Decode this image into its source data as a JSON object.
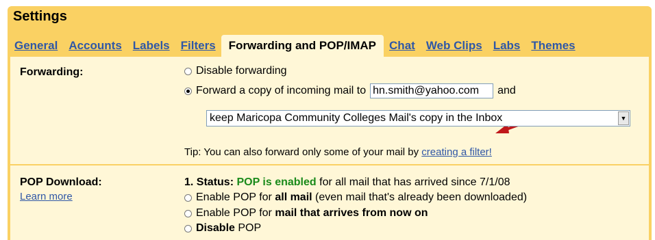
{
  "settings": {
    "title": "Settings"
  },
  "tabs": [
    {
      "label": "General"
    },
    {
      "label": "Accounts"
    },
    {
      "label": "Labels"
    },
    {
      "label": "Filters"
    },
    {
      "label": "Forwarding and POP/IMAP",
      "active": true
    },
    {
      "label": "Chat"
    },
    {
      "label": "Web Clips"
    },
    {
      "label": "Labs"
    },
    {
      "label": "Themes"
    }
  ],
  "forwarding": {
    "label": "Forwarding:",
    "disable_label": "Disable forwarding",
    "forward_label": "Forward a copy of incoming mail to",
    "email_value": "hn.smith@yahoo.com",
    "and_label": "and",
    "selected_option": "keep Maricopa Community Colleges Mail's copy in the Inbox",
    "tip_text": "Tip: You can also forward only some of your mail by",
    "tip_link": "creating a filter!"
  },
  "pop": {
    "label": "POP Download:",
    "learn_more": "Learn more",
    "status_prefix": "1. Status:",
    "status_value": "POP is enabled",
    "status_suffix": "for all mail that has arrived since 7/1/08",
    "opt1_prefix": "Enable POP for",
    "opt1_bold": "all mail",
    "opt1_suffix": "(even mail that's already been downloaded)",
    "opt2_prefix": "Enable POP for",
    "opt2_bold": "mail that arrives from now on",
    "opt3_bold": "Disable",
    "opt3_suffix": "POP"
  },
  "colors": {
    "header_bg": "#fad163",
    "panel_bg": "#fff7d7",
    "link": "#2f57a6",
    "status_green": "#1a8a1a",
    "arrow_red": "#c0181b"
  }
}
